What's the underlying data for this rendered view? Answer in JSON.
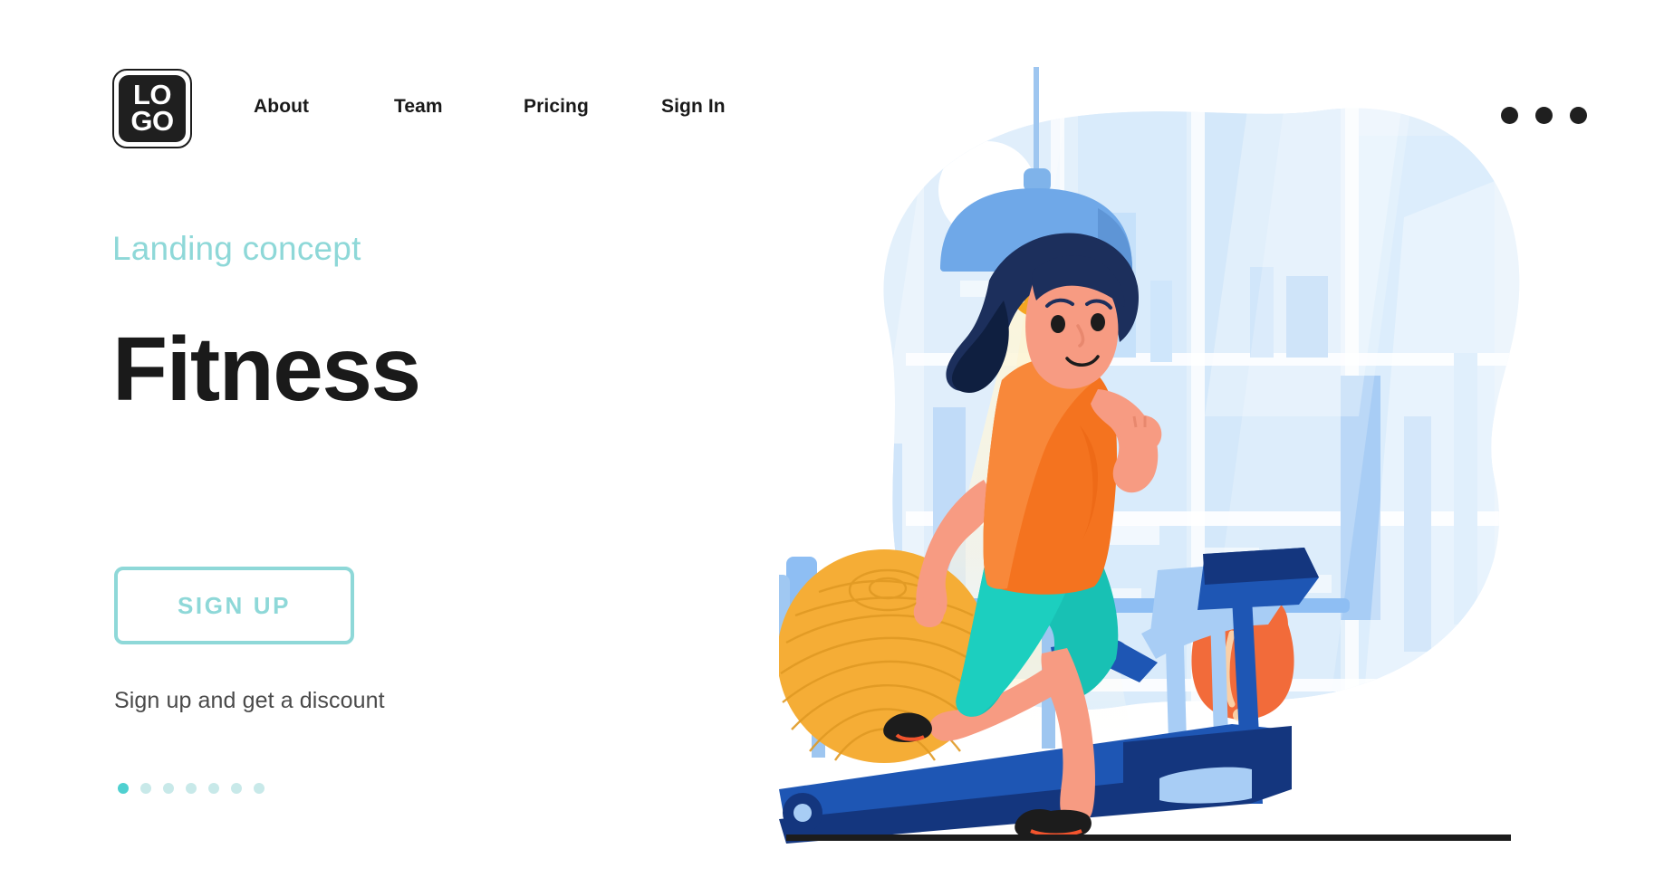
{
  "brand": {
    "logo_line1": "LO",
    "logo_line2": "GO",
    "logo_icon": "logo-mark"
  },
  "nav": {
    "items": [
      {
        "label": "About"
      },
      {
        "label": "Team"
      },
      {
        "label": "Pricing"
      },
      {
        "label": "Sign In"
      }
    ],
    "overflow_icon": "ellipsis-menu-icon"
  },
  "hero": {
    "eyebrow": "Landing concept",
    "headline": "Fitness",
    "cta_label": "SIGN UP",
    "subtext": "Sign up and get a discount"
  },
  "pagination": {
    "total": 7,
    "active_index": 0
  },
  "illustration": {
    "name": "woman-running-on-treadmill-in-gym",
    "elements": [
      "background-blob",
      "gym-window-bars",
      "pendant-lamp",
      "light-beam",
      "barbell-rack",
      "exercise-ball",
      "treadmill",
      "kettlebell",
      "running-woman",
      "floor-line"
    ]
  },
  "colors": {
    "accent_teal": "#8ed8d8",
    "accent_teal_strong": "#4fd0d0",
    "text_dark": "#1a1a1a",
    "text_muted": "#4a4a4a",
    "blob_blue": "#e3f0fb",
    "bar_blue": "#a8cdf5",
    "lamp_blue": "#6fa8e8",
    "treadmill_blue": "#1e56b4",
    "treadmill_blue_dark": "#14367e",
    "treadmill_blue_light": "#a8cdf5",
    "shirt_orange": "#f4731f",
    "shorts_teal": "#18c1b4",
    "skin": "#f79b82",
    "hair_navy": "#1c2f5c",
    "ball_yellow": "#f5ad36",
    "bulb_orange": "#f5a623",
    "kettlebell_orange": "#f26b3a",
    "floor": "#1c1c1c",
    "page_bg": "#ffffff"
  }
}
